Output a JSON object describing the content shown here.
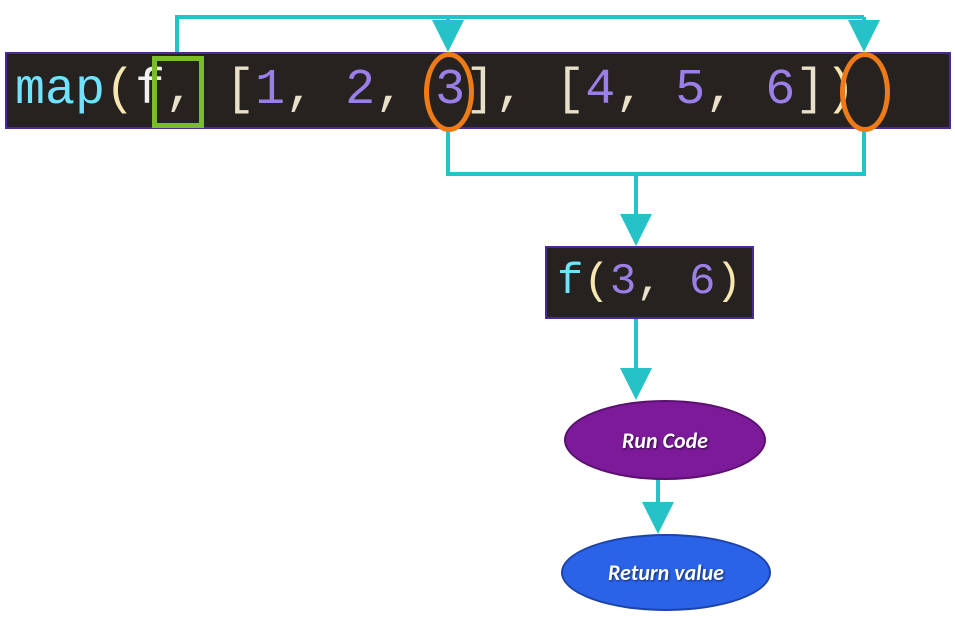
{
  "diagram": {
    "map_call": {
      "fn": "map",
      "open": "(",
      "f": "f",
      "sep1": ", ",
      "open1": "[",
      "n1": "1",
      "c1": ", ",
      "n2": "2",
      "c2": ", ",
      "n3": "3",
      "close1": "]",
      "sep2": ", ",
      "open2": "[",
      "n4": "4",
      "c3": ", ",
      "n5": "5",
      "c4": ", ",
      "n6": "6",
      "close2": "]",
      "close": ")"
    },
    "apply_call": {
      "f": "f",
      "open": "(",
      "a": "3",
      "sep": ", ",
      "b": "6",
      "close": ")"
    },
    "run_code_label": "Run Code",
    "return_value_label": "Return value",
    "colors": {
      "arrow": "#25c3c7",
      "highlight_box": "#79bd2a",
      "highlight_circle": "#ee7b18",
      "run_oval": "#7c1a9a",
      "return_oval": "#2a63e8"
    }
  }
}
